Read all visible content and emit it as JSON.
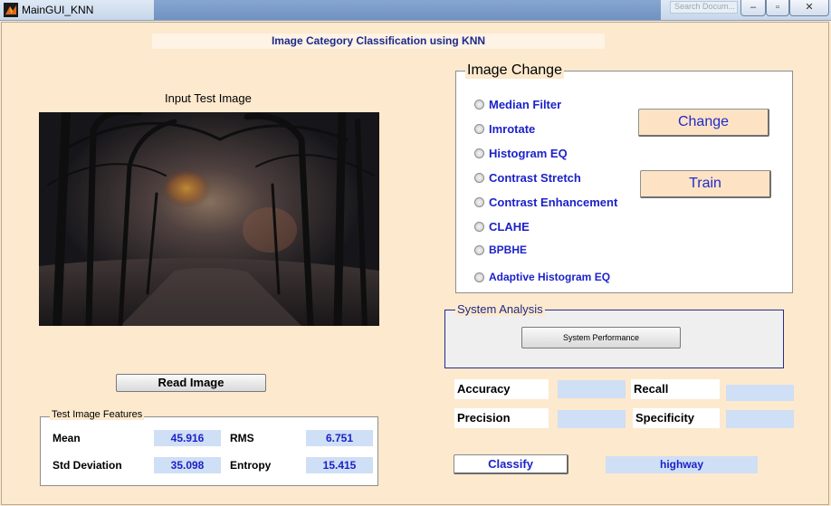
{
  "window": {
    "title": "MainGUI_KNN",
    "search_placeholder": "Search Docum...",
    "minimize_label": "–",
    "maximize_label": "▫",
    "close_label": "✕"
  },
  "banner": {
    "title": "Image Category Classification using KNN"
  },
  "input_image": {
    "label": "Input Test Image",
    "description": "forest path photo"
  },
  "read_image_button": "Read Image",
  "image_change": {
    "legend": "Image Change",
    "options": [
      "Median Filter",
      "Imrotate",
      "Histogram EQ",
      "Contrast Stretch",
      "Contrast Enhancement",
      "CLAHE",
      "BPBHE",
      "Adaptive Histogram EQ"
    ],
    "change_button": "Change",
    "train_button": "Train"
  },
  "system_analysis": {
    "legend": "System Analysis",
    "performance_button": "System Performance"
  },
  "metrics": {
    "accuracy_label": "Accuracy",
    "accuracy_value": "",
    "recall_label": "Recall",
    "recall_value": "",
    "precision_label": "Precision",
    "precision_value": "",
    "specificity_label": "Specificity",
    "specificity_value": ""
  },
  "classify": {
    "button": "Classify",
    "result": "highway"
  },
  "features": {
    "legend": "Test Image Features",
    "mean_label": "Mean",
    "mean_value": "45.916",
    "rms_label": "RMS",
    "rms_value": "6.751",
    "std_label": "Std Deviation",
    "std_value": "35.098",
    "entropy_label": "Entropy",
    "entropy_value": "15.415"
  },
  "colors": {
    "background": "#fde9cd",
    "accent_text": "#1c22c8",
    "value_box": "#cfdff5"
  }
}
